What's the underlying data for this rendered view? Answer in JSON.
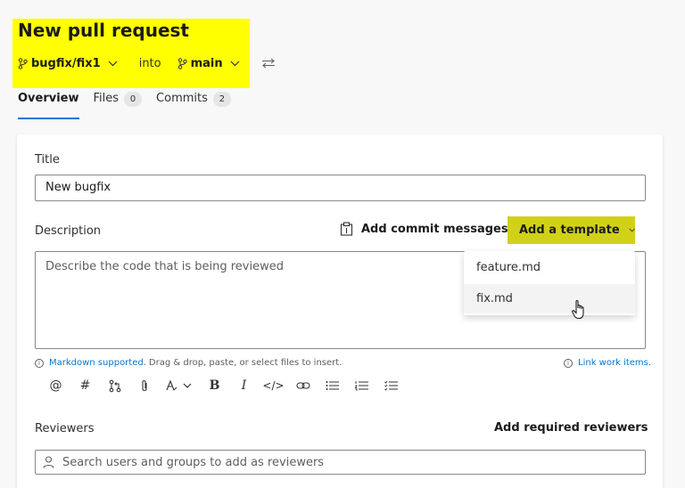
{
  "header": {
    "title": "New pull request",
    "source_branch": "bugfix/fix1",
    "into_label": "into",
    "target_branch": "main"
  },
  "tabs": [
    {
      "label": "Overview",
      "active": true
    },
    {
      "label": "Files",
      "count": "0"
    },
    {
      "label": "Commits",
      "count": "2"
    }
  ],
  "form": {
    "title_label": "Title",
    "title_value": "New bugfix",
    "description_label": "Description",
    "add_commit_messages": "Add commit messages",
    "add_template": "Add a template",
    "description_placeholder": "Describe the code that is being reviewed",
    "markdown_link": "Markdown supported.",
    "markdown_hint": "Drag & drop, paste, or select files to insert.",
    "link_work_items": "Link work items.",
    "reviewers_label": "Reviewers",
    "add_required_reviewers": "Add required reviewers",
    "reviewers_placeholder": "Search users and groups to add as reviewers"
  },
  "template_menu": {
    "items": [
      "feature.md",
      "fix.md"
    ],
    "hovered_index": 1
  },
  "toolbar": {
    "icons": [
      "mention-icon",
      "hashtag-icon",
      "pull-request-icon",
      "attach-icon",
      "highlight-icon",
      "bold-icon",
      "italic-icon",
      "code-icon",
      "link-icon",
      "bulleted-list-icon",
      "numbered-list-icon",
      "task-list-icon"
    ]
  },
  "colors": {
    "highlight": "#ffff00",
    "accent": "#0078d4",
    "template_button": "#d1d119"
  }
}
